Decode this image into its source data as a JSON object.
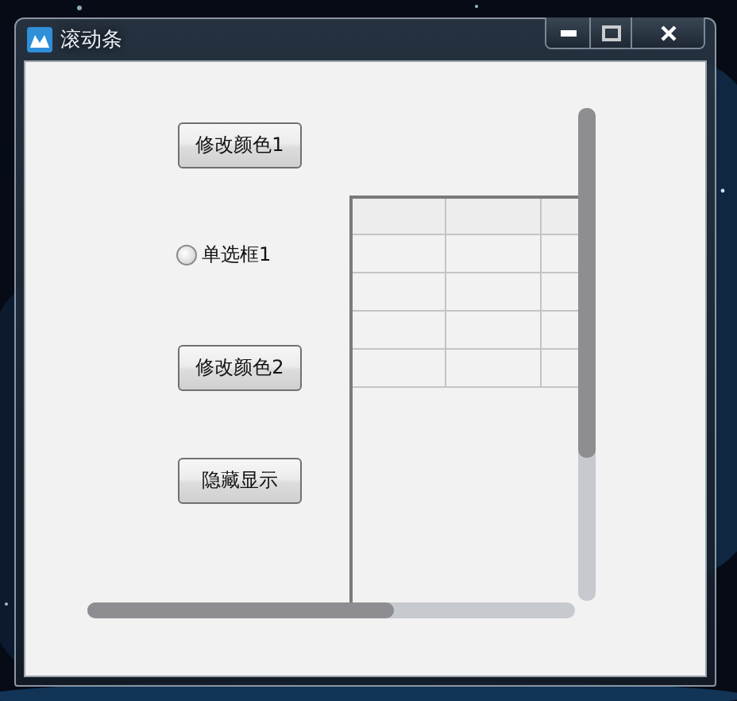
{
  "window": {
    "title": "滚动条"
  },
  "controls": [
    {
      "kind": "button",
      "label": "修改颜色1"
    },
    {
      "kind": "radio",
      "label": "单选框1",
      "selected": false
    },
    {
      "kind": "button",
      "label": "修改颜色2"
    },
    {
      "kind": "button",
      "label": "隐藏显示"
    }
  ]
}
